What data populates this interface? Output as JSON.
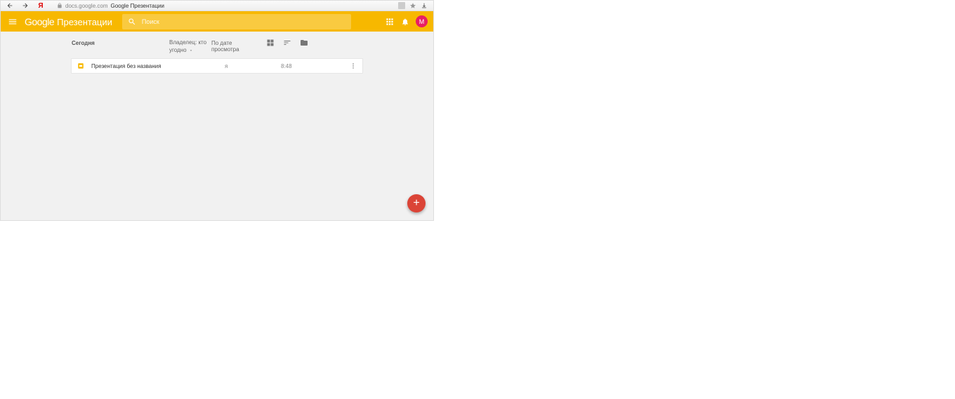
{
  "browser": {
    "domain": "docs.google.com",
    "title": "Google Презентации"
  },
  "header": {
    "logo": "Google",
    "product": "Презентации",
    "search_placeholder": "Поиск",
    "avatar_letter": "М"
  },
  "controls": {
    "section": "Сегодня",
    "owner_line1": "Владелец: кто",
    "owner_line2": "угодно",
    "sort": "По дате просмотра"
  },
  "files": [
    {
      "name": "Презентация без названия",
      "owner": "я",
      "time": "8:48"
    }
  ],
  "fab": {
    "label": "+"
  }
}
